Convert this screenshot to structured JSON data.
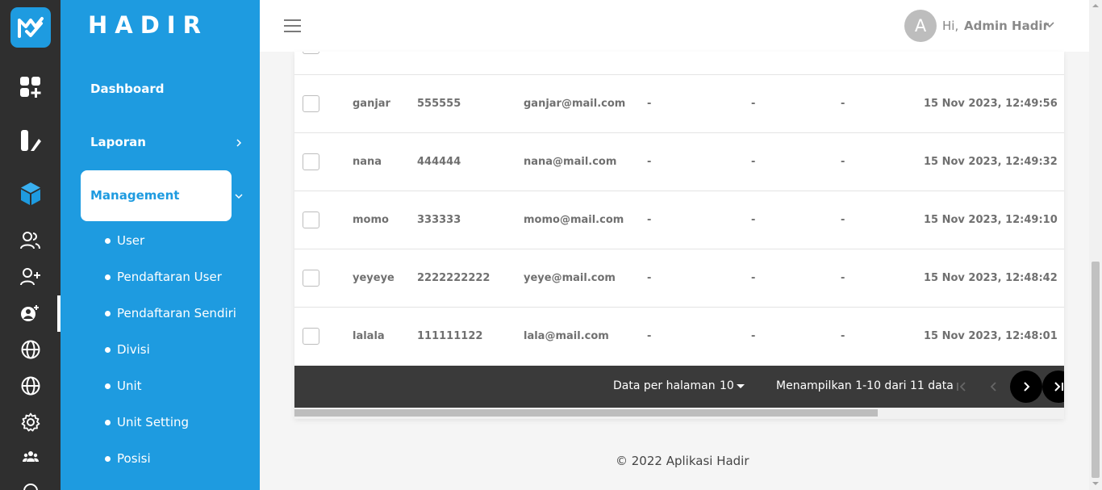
{
  "brand": "HADIR",
  "sidebar": {
    "dashboard": "Dashboard",
    "laporan": "Laporan",
    "management": "Management",
    "sub_items": [
      "User",
      "Pendaftaran User",
      "Pendaftaran Sendiri",
      "Divisi",
      "Unit",
      "Unit Setting",
      "Posisi"
    ]
  },
  "header": {
    "avatar_initial": "A",
    "greeting": "Hi,",
    "user_name": "Admin Hadir"
  },
  "table": {
    "rows": [
      {
        "name": "ganjar",
        "nik": "555555",
        "email": "ganjar@mail.com",
        "col_a": "-",
        "col_b": "-",
        "col_c": "-",
        "date": "15 Nov 2023, 12:49:56"
      },
      {
        "name": "nana",
        "nik": "444444",
        "email": "nana@mail.com",
        "col_a": "-",
        "col_b": "-",
        "col_c": "-",
        "date": "15 Nov 2023, 12:49:32"
      },
      {
        "name": "momo",
        "nik": "333333",
        "email": "momo@mail.com",
        "col_a": "-",
        "col_b": "-",
        "col_c": "-",
        "date": "15 Nov 2023, 12:49:10"
      },
      {
        "name": "yeyeye",
        "nik": "2222222222",
        "email": "yeye@mail.com",
        "col_a": "-",
        "col_b": "-",
        "col_c": "-",
        "date": "15 Nov 2023, 12:48:42"
      },
      {
        "name": "lalala",
        "nik": "111111122",
        "email": "lala@mail.com",
        "col_a": "-",
        "col_b": "-",
        "col_c": "-",
        "date": "15 Nov 2023, 12:48:01"
      }
    ]
  },
  "pagination": {
    "per_page_label": "Data per halaman",
    "per_page_value": "10",
    "range_text": "Menampilkan 1-10 dari 11 data"
  },
  "footer": "© 2022 Aplikasi Hadir",
  "colors": {
    "primary": "#1e9be0",
    "rail": "#2f2f2f",
    "pager": "#3a3a3a"
  },
  "icons": [
    "app-logo-icon",
    "dashboard-icon",
    "report-icon",
    "management-cube-icon",
    "users-icon",
    "user-add-icon",
    "user-self-register-icon",
    "globe-icon",
    "globe-icon",
    "gear-icon",
    "team-icon",
    "menu-icon",
    "chevron-down-icon",
    "chevron-right-icon",
    "first-page-icon",
    "prev-page-icon",
    "next-page-icon",
    "last-page-icon"
  ]
}
